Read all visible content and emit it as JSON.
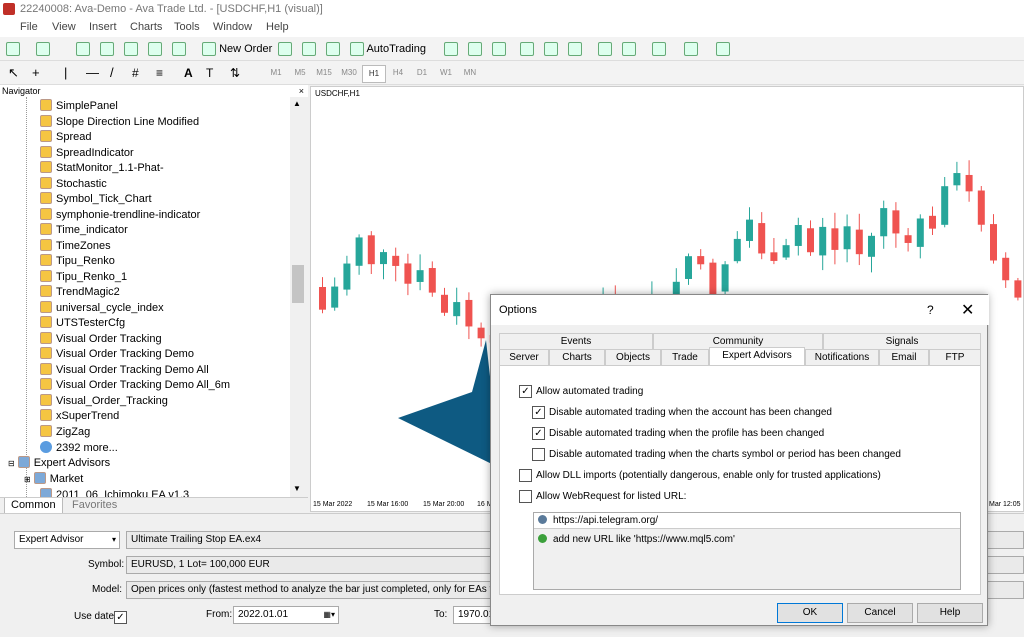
{
  "window": {
    "title": "22240008: Ava-Demo - Ava Trade Ltd. - [USDCHF,H1 (visual)]"
  },
  "menu": [
    "File",
    "View",
    "Insert",
    "Charts",
    "Tools",
    "Window",
    "Help"
  ],
  "toolbar": {
    "new_order": "New Order",
    "autotrading": "AutoTrading",
    "draw_text": "A"
  },
  "timeframes": [
    "M1",
    "M5",
    "M15",
    "M30",
    "H1",
    "H4",
    "D1",
    "W1",
    "MN"
  ],
  "active_timeframe": "H1",
  "navigator": {
    "title": "Navigator",
    "close": "×",
    "items": [
      "SimplePanel",
      "Slope Direction Line Modified",
      "Spread",
      "SpreadIndicator",
      "StatMonitor_1.1-Phat-",
      "Stochastic",
      "Symbol_Tick_Chart",
      "symphonie-trendline-indicator",
      "Time_indicator",
      "TimeZones",
      "Tipu_Renko",
      "Tipu_Renko_1",
      "TrendMagic2",
      "universal_cycle_index",
      "UTSTesterCfg",
      "Visual Order Tracking",
      "Visual Order Tracking Demo",
      "Visual Order Tracking Demo All",
      "Visual Order Tracking Demo All_6m",
      "Visual_Order_Tracking",
      "xSuperTrend",
      "ZigZag"
    ],
    "more": "2392 more...",
    "expert_advisors": "Expert Advisors",
    "market": "Market",
    "partial": "2011_06_Ichimoku EA v1.3",
    "tabs": [
      "Common",
      "Favorites"
    ]
  },
  "chart": {
    "symbol_label": "USDCHF,H1",
    "x_labels": [
      "15 Mar 2022",
      "15 Mar 16:00",
      "15 Mar 20:00",
      "16 M",
      "Mar 12:05"
    ],
    "up_color": "#26a69a",
    "down_color": "#ef5350"
  },
  "chart_data": {
    "type": "candlestick",
    "title": "USDCHF,H1",
    "x_labels": [
      "15 Mar 2022",
      "15 Mar 16:00",
      "15 Mar 20:00",
      "16 M",
      "Mar 12:05"
    ],
    "candles_dir": [
      -1,
      1,
      1,
      1,
      -1,
      1,
      -1,
      -1,
      1,
      -1,
      -1,
      1,
      -1,
      -1,
      -1,
      -1,
      1,
      1,
      -1,
      1,
      -1,
      1,
      1,
      1,
      -1,
      -1,
      1,
      1,
      -1,
      1,
      1,
      -1,
      -1,
      1,
      1,
      1,
      -1,
      -1,
      1,
      1,
      -1,
      1,
      -1,
      1,
      -1,
      1,
      1,
      -1,
      -1,
      1,
      -1,
      1,
      1,
      -1,
      -1,
      -1,
      -1,
      -1
    ]
  },
  "tester": {
    "program_type": "Expert Advisor",
    "expert_file": "Ultimate Trailing Stop EA.ex4",
    "symbol_label": "Symbol:",
    "symbol_value": "EURUSD, 1 Lot= 100,000 EUR",
    "model_label": "Model:",
    "model_value": "Open prices only (fastest method to analyze the bar just completed, only for EAs that explic",
    "use_date_label": "Use date",
    "use_date_check": "✓",
    "from_label": "From:",
    "from_value": "2022.01.01",
    "to_label": "To:",
    "to_value": "1970.01"
  },
  "dialog": {
    "title": "Options",
    "help": "?",
    "close": "✕",
    "tabs_row1": [
      "Events",
      "Community",
      "Signals"
    ],
    "tabs_row2": [
      "Server",
      "Charts",
      "Objects",
      "Trade",
      "Expert Advisors",
      "Notifications",
      "Email",
      "FTP"
    ],
    "active_tab": "Expert Advisors",
    "options": [
      {
        "label": "Allow automated trading",
        "checked": true
      },
      {
        "label": "Disable automated trading when the account has been changed",
        "checked": true
      },
      {
        "label": "Disable automated trading when the profile has been changed",
        "checked": true
      },
      {
        "label": "Disable automated trading when the charts symbol or period has been changed",
        "checked": false
      },
      {
        "label": "Allow DLL imports (potentially dangerous, enable only for trusted applications)",
        "checked": false
      },
      {
        "label": "Allow WebRequest for listed URL:",
        "checked": false
      }
    ],
    "urls": [
      "https://api.telegram.org/"
    ],
    "add_url": "add new URL like 'https://www.mql5.com'",
    "buttons": {
      "ok": "OK",
      "cancel": "Cancel",
      "help": "Help"
    }
  }
}
